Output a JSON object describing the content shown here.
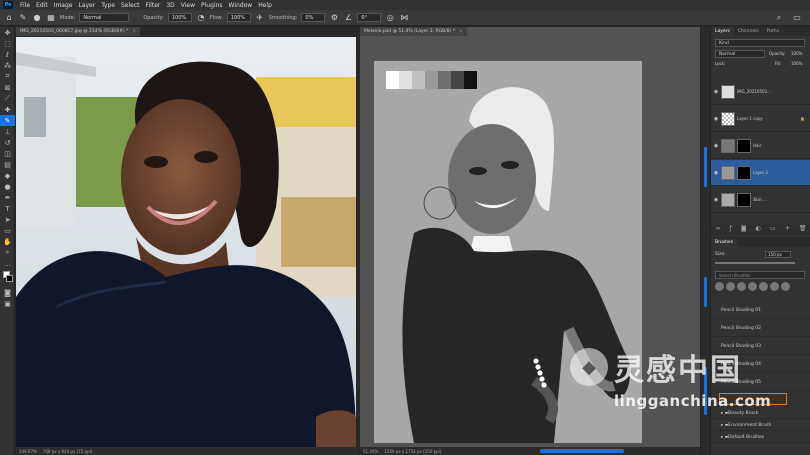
{
  "menu": {
    "logo": "Ps",
    "items": [
      "File",
      "Edit",
      "Image",
      "Layer",
      "Type",
      "Select",
      "Filter",
      "3D",
      "View",
      "Plugins",
      "Window",
      "Help"
    ]
  },
  "options": {
    "mode_label": "Mode:",
    "mode_value": "Normal",
    "opacity_label": "Opacity:",
    "opacity_value": "100%",
    "flow_label": "Flow:",
    "flow_value": "100%",
    "smoothing_label": "Smoothing:",
    "smoothing_value": "0%",
    "angle_value": "0°"
  },
  "doc1": {
    "tab": "IMG_20210503_060817.jpg @ 214% (RGB/8#) *",
    "zoom": "249.67%",
    "size": "768 px x 944 px (72 ppi)"
  },
  "doc2": {
    "tab": "Melanie.psd @ 51.4% (Layer 2, RGB/8) *",
    "zoom": "51.44%",
    "size": "1240 px x 1754 px (150 ppi)"
  },
  "layers_panel": {
    "tabs": [
      "Layers",
      "Channels",
      "Paths"
    ],
    "kind": "Kind",
    "blend": "Normal",
    "opacity_label": "Opacity:",
    "opacity": "100%",
    "lock_label": "Lock:",
    "fill_label": "Fill:",
    "fill": "100%",
    "layers": [
      {
        "name": "IMG_20210503..."
      },
      {
        "name": "Layer 1 copy"
      },
      {
        "name": "Hair"
      },
      {
        "name": "Layer 2"
      },
      {
        "name": "Skin ..."
      }
    ]
  },
  "brushes_panel": {
    "title": "Brushes",
    "size_label": "Size:",
    "size_value": "150 px",
    "search_placeholder": "Search Brushes",
    "presets": [
      "Pencil Shading 01",
      "Pencil Shading 02",
      "Pencil Shading 03",
      "Pencil Shading 04",
      "Pencil Shading 05"
    ],
    "folders": [
      "Beauty Brush",
      "Environment Brush",
      "Default Brushes"
    ]
  },
  "watermark": {
    "cn": "灵感中国",
    "url": "lingganchina.com"
  }
}
